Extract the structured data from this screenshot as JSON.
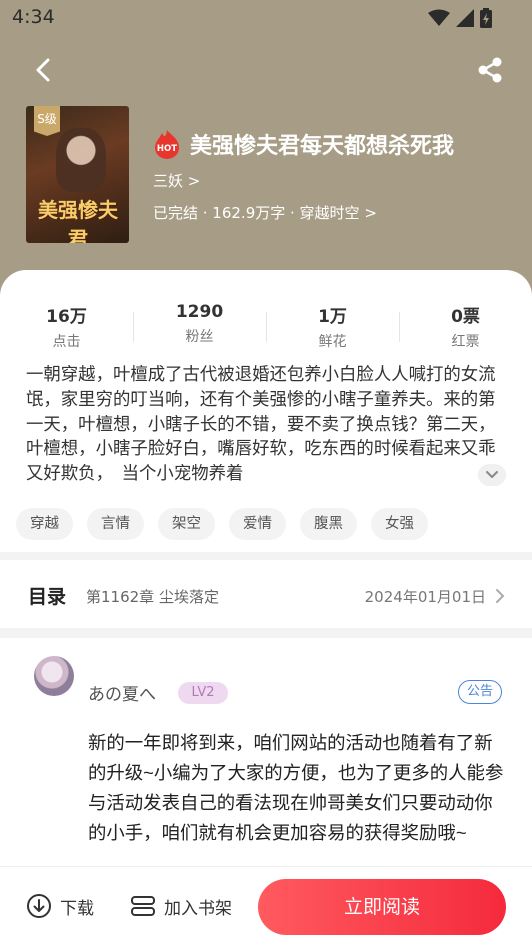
{
  "status_bar": {
    "time": "4:34"
  },
  "book": {
    "cover_badge": "S级",
    "cover_title": "美强惨夫君",
    "hot_label": "HOT",
    "title": "美强惨夫君每天都想杀死我",
    "author": "三妖 >",
    "meta": "已完结 · 162.9万字 · 穿越时空 >"
  },
  "stats": [
    {
      "value": "16万",
      "label": "点击"
    },
    {
      "value": "1290",
      "label": "粉丝"
    },
    {
      "value": "1万",
      "label": "鲜花"
    },
    {
      "value": "0票",
      "label": "红票"
    }
  ],
  "synopsis": "一朝穿越，叶檀成了古代被退婚还包养小白脸人人喊打的女流氓，家里穷的叮当响，还有个美强惨的小瞎子童养夫。来的第一天，叶檀想，小瞎子长的不错，要不卖了换点钱？第二天，叶檀想，小瞎子脸好白，嘴唇好软，吃东西的时候看起来又乖又好欺负，　当个小宠物养着",
  "tags": [
    "穿越",
    "言情",
    "架空",
    "爱情",
    "腹黑",
    "女强"
  ],
  "toc": {
    "title": "目录",
    "latest_chapter": "第1162章 尘埃落定",
    "date": "2024年01月01日"
  },
  "post": {
    "username": "あの夏へ",
    "level": "LV2",
    "badge": "公告",
    "body": "新的一年即将到来，咱们网站的活动也随着有了新的升级~小编为了大家的方便，也为了更多的人能参与活动发表自己的看法现在帅哥美女们只要动动你的小手，咱们就有机会更加容易的获得奖励哦~"
  },
  "bottom_bar": {
    "download_label": "下载",
    "shelf_label": "加入书架",
    "read_label": "立即阅读"
  },
  "colors": {
    "hero_bg": "#a79d86",
    "accent_red": "#f52a3c",
    "notice_blue": "#4a86d8",
    "level_purple": "#b07ab6"
  }
}
